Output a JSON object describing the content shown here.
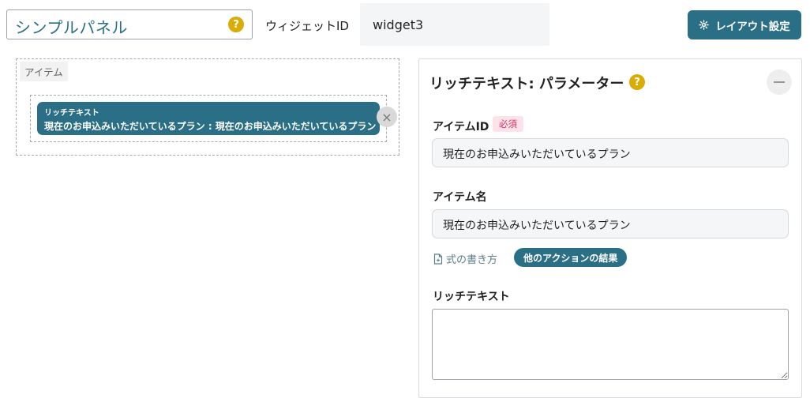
{
  "header": {
    "panel_title": "シンプルパネル",
    "help_glyph": "?",
    "widget_id_label": "ウィジェットID",
    "widget_id_value": "widget3",
    "layout_button_label": "レイアウト設定",
    "layout_button_icon": "gear-icon"
  },
  "items_area": {
    "label": "アイテム",
    "item": {
      "type_label": "リッチテキスト",
      "text": "現在のお申込みいただいているプラン : 現在のお申込みいただいているプラン"
    },
    "remove_glyph": "×"
  },
  "param_panel": {
    "title": "リッチテキスト: パラメーター",
    "help_glyph": "?",
    "item_id": {
      "label": "アイテムID",
      "required_badge": "必須",
      "value": "現在のお申込みいただいているプラン"
    },
    "item_name": {
      "label": "アイテム名",
      "value": "現在のお申込みいただいているプラン"
    },
    "formula_link": "式の書き方",
    "other_action_button": "他のアクションの結果",
    "richtext": {
      "label": "リッチテキスト",
      "value": ""
    }
  },
  "colors": {
    "accent": "#2a6f86",
    "help": "#d9ad05",
    "required_bg": "#fde2ea",
    "required_text": "#d63462"
  }
}
